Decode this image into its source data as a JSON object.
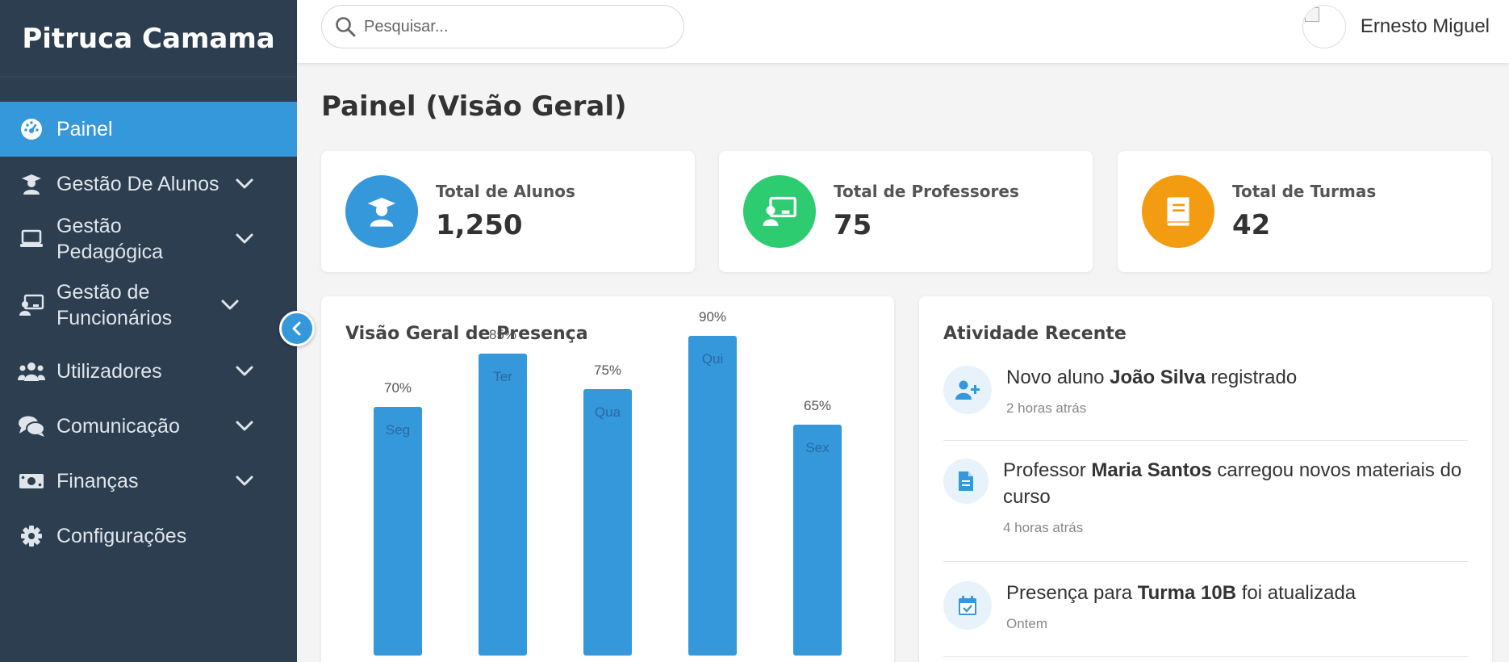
{
  "app": {
    "brand": "Pitruca Camama"
  },
  "sidebar": {
    "items": [
      {
        "label": "Painel",
        "icon": "dashboard-icon",
        "active": true,
        "has_submenu": false
      },
      {
        "label": "Gestão De Alunos",
        "icon": "graduate-icon",
        "active": false,
        "has_submenu": true
      },
      {
        "label": "Gestão Pedagógica",
        "icon": "laptop-icon",
        "active": false,
        "has_submenu": true
      },
      {
        "label": "Gestão de Funcionários",
        "icon": "teacher-board-icon",
        "active": false,
        "has_submenu": true
      },
      {
        "label": "Utilizadores",
        "icon": "users-icon",
        "active": false,
        "has_submenu": true
      },
      {
        "label": "Comunicação",
        "icon": "chat-icon",
        "active": false,
        "has_submenu": true
      },
      {
        "label": "Finanças",
        "icon": "money-icon",
        "active": false,
        "has_submenu": true
      },
      {
        "label": "Configurações",
        "icon": "gear-icon",
        "active": false,
        "has_submenu": false
      }
    ]
  },
  "search": {
    "placeholder": "Pesquisar..."
  },
  "user": {
    "name": "Ernesto Miguel"
  },
  "page": {
    "title": "Painel (Visão Geral)"
  },
  "stats": [
    {
      "label": "Total de Alunos",
      "value": "1,250",
      "icon": "graduate-icon",
      "color": "#3498db"
    },
    {
      "label": "Total de Professores",
      "value": "75",
      "icon": "teacher-board-icon",
      "color": "#2ecc71"
    },
    {
      "label": "Total de Turmas",
      "value": "42",
      "icon": "book-icon",
      "color": "#f39c12"
    }
  ],
  "attendance": {
    "title": "Visão Geral de Presença"
  },
  "chart_data": {
    "type": "bar",
    "title": "Visão Geral de Presença",
    "categories": [
      "Seg",
      "Ter",
      "Qua",
      "Qui",
      "Sex"
    ],
    "values": [
      70,
      85,
      75,
      90,
      65
    ],
    "value_labels": [
      "70%",
      "85%",
      "75%",
      "90%",
      "65%"
    ],
    "unit": "%",
    "ylim": [
      0,
      100
    ],
    "bar_color": "#3498db",
    "grid": false,
    "legend": "none"
  },
  "activity": {
    "title": "Atividade Recente",
    "items": [
      {
        "icon": "user-plus-icon",
        "pre": "Novo aluno ",
        "bold": "João Silva",
        "post": " registrado",
        "time": "2 horas atrás"
      },
      {
        "icon": "document-icon",
        "pre": "Professor ",
        "bold": "Maria Santos",
        "post": " carregou novos materiais do curso",
        "time": "4 horas atrás"
      },
      {
        "icon": "calendar-check-icon",
        "pre": "Presença para ",
        "bold": "Turma 10B",
        "post": " foi atualizada",
        "time": "Ontem"
      }
    ]
  },
  "colors": {
    "sidebar_bg": "#2c3e50",
    "accent": "#3498db",
    "green": "#2ecc71",
    "orange": "#f39c12",
    "page_bg": "#f4f4f4"
  }
}
